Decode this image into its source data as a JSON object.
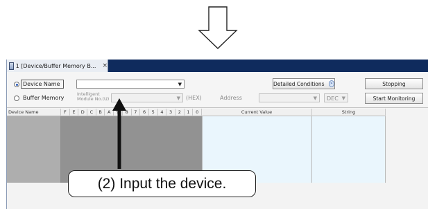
{
  "tab": {
    "title": "1 [Device/Buffer Memory B...",
    "close": "×"
  },
  "toolbar": {
    "device_name_label": "Device Name",
    "buffer_memory_label": "Buffer Memory",
    "device_input_value": "",
    "intelligent_label_line1": "Intelligent",
    "intelligent_label_line2": "Module No.(U)",
    "hex_label": "(HEX)",
    "address_label": "Address",
    "address_format": "DEC",
    "detailed_conditions_label": "Detailed Conditions",
    "stopping_label": "Stopping",
    "start_monitoring_label": "Start Monitoring"
  },
  "grid": {
    "device_name_header": "Device Name",
    "bit_headers": [
      "F",
      "E",
      "D",
      "C",
      "B",
      "A",
      "9",
      "8",
      "7",
      "6",
      "5",
      "4",
      "3",
      "2",
      "1",
      "0"
    ],
    "current_value_header": "Current Value",
    "string_header": "String"
  },
  "annotation": {
    "callout_text": "(2) Input the device."
  },
  "colors": {
    "tab_bar": "#0f2b5d",
    "value_cell": "#eaf6fd",
    "bit_cell": "#929292",
    "name_cell": "#aeaeae"
  }
}
